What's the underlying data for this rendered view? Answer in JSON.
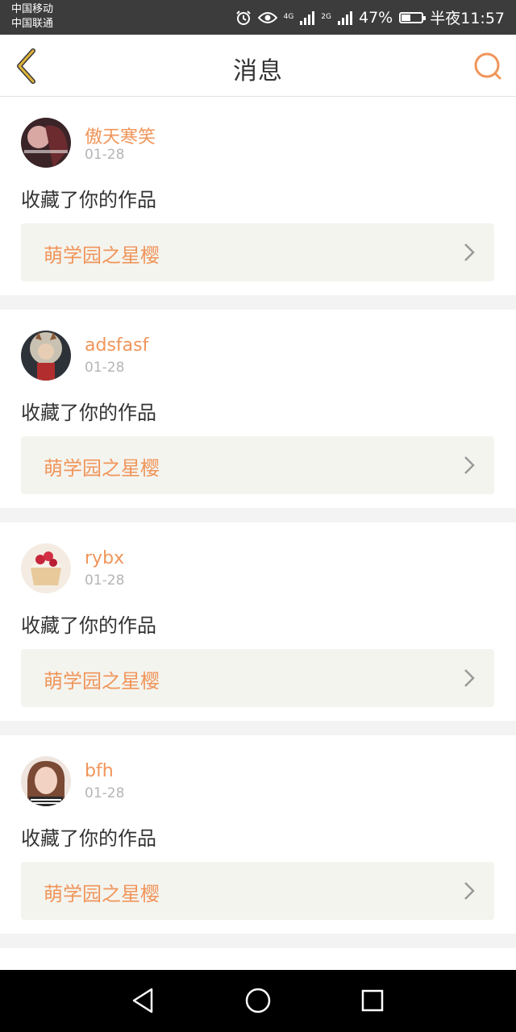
{
  "status_bar": {
    "carrier1": "中国移动",
    "carrier2": "中国联通",
    "net1": "4G",
    "net2": "2G",
    "battery": "47%",
    "battery_level": 0.47,
    "time": "半夜11:57"
  },
  "header": {
    "title": "消息",
    "back_icon": "chevron-left-icon",
    "search_icon": "search-icon"
  },
  "messages": [
    {
      "user": "傲天寒笑",
      "date": "01-28",
      "action": "收藏了你的作品",
      "work": "萌学园之星樱"
    },
    {
      "user": "adsfasf",
      "date": "01-28",
      "action": "收藏了你的作品",
      "work": "萌学园之星樱"
    },
    {
      "user": "rybx",
      "date": "01-28",
      "action": "收藏了你的作品",
      "work": "萌学园之星樱"
    },
    {
      "user": "bfh",
      "date": "01-28",
      "action": "收藏了你的作品",
      "work": "萌学园之星樱"
    }
  ],
  "nav": {
    "back": "back-triangle-icon",
    "home": "home-circle-icon",
    "recents": "recents-square-icon"
  },
  "colors": {
    "accent": "#f0955a",
    "back_icon": "#d4a630",
    "background": "#f3f3f3"
  }
}
